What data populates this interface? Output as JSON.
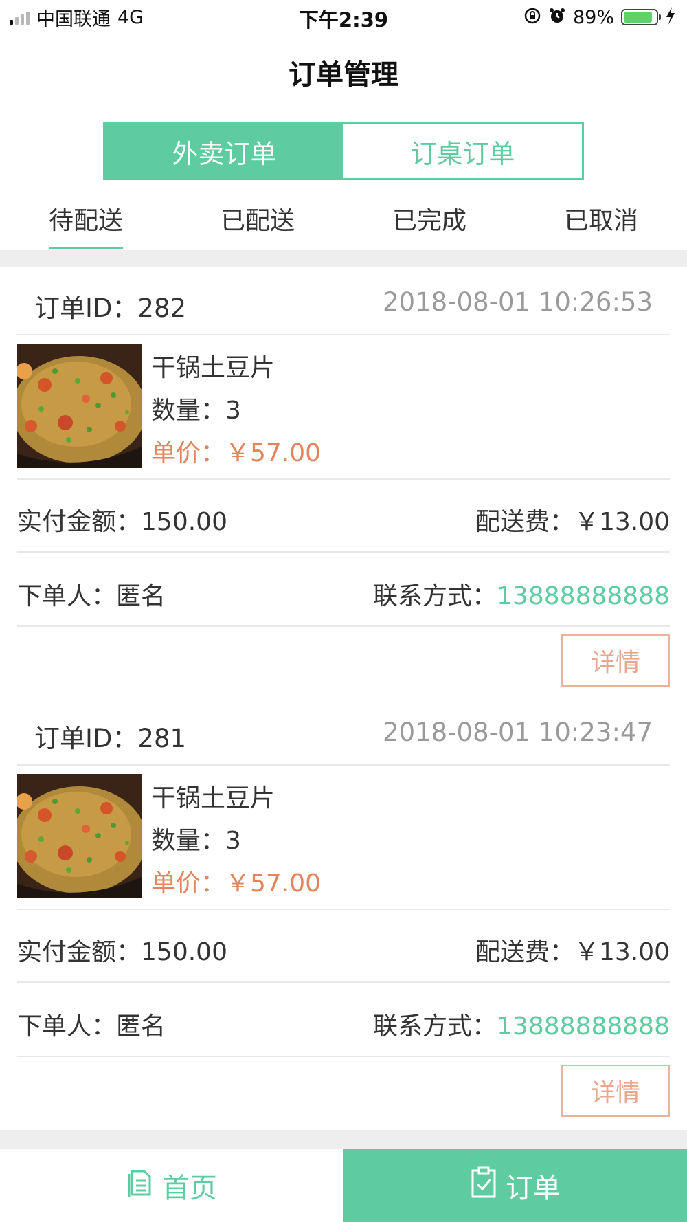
{
  "status_bar": {
    "carrier": "中国联通",
    "network": "4G",
    "time": "下午2:39",
    "battery": "89%",
    "battery_level": 0.89,
    "icons": [
      "signal-icon",
      "rotation-lock-icon",
      "alarm-icon",
      "battery-icon",
      "charging-icon"
    ]
  },
  "header": {
    "title": "订单管理"
  },
  "segment": {
    "items": [
      "外卖订单",
      "订桌订单"
    ],
    "selected": "外卖订单"
  },
  "tabs": {
    "items": [
      "待配送",
      "已配送",
      "已完成",
      "已取消"
    ],
    "selected": "待配送"
  },
  "orders": [
    {
      "id_label": "订单ID：",
      "id": "282",
      "time": "2018-08-01 10:26:53",
      "item_name": "干锅土豆片",
      "qty_label": "数量：",
      "qty": "3",
      "unit_price": "单价：￥57.00",
      "paid_label": "实付金额：",
      "paid": "150.00",
      "delivery_fee": "配送费：￥13.00",
      "customer_label": "下单人：",
      "customer": "匿名",
      "contact_label": "联系方式：",
      "contact": "13888888888",
      "detail_button": "详情"
    },
    {
      "id_label": "订单ID：",
      "id": "281",
      "time": "2018-08-01 10:23:47",
      "item_name": "干锅土豆片",
      "qty_label": "数量：",
      "qty": "3",
      "unit_price": "单价：￥57.00",
      "paid_label": "实付金额：",
      "paid": "150.00",
      "delivery_fee": "配送费：￥13.00",
      "customer_label": "下单人：",
      "customer": "匿名",
      "contact_label": "联系方式：",
      "contact": "13888888888",
      "detail_button": "详情"
    }
  ],
  "tabbar": {
    "items": [
      {
        "label": "首页",
        "icon": "document-icon"
      },
      {
        "label": "订单",
        "icon": "clipboard-check-icon"
      }
    ],
    "selected": "订单"
  },
  "colors": {
    "accent": "#5ecca0",
    "price": "#e2845c",
    "detail_border": "#e9b49e",
    "band": "#eeeeee"
  }
}
